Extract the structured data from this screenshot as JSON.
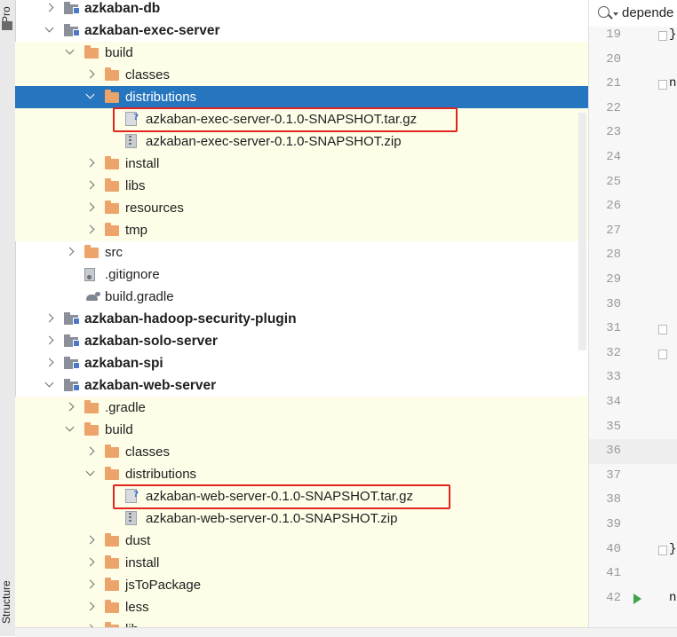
{
  "left_strip": {
    "top_tab": "Pro",
    "bottom_tab": "Structure"
  },
  "tree": {
    "rows": [
      {
        "label": "azkaban-db",
        "icon": "module-icon",
        "arrow": "right",
        "indent": 0,
        "bold": true,
        "highlight": false,
        "selected": false
      },
      {
        "label": "azkaban-exec-server",
        "icon": "module-icon",
        "arrow": "down",
        "indent": 0,
        "bold": true,
        "highlight": false,
        "selected": false
      },
      {
        "label": "build",
        "icon": "folder-icon",
        "arrow": "down",
        "indent": 1,
        "bold": false,
        "highlight": true,
        "selected": false
      },
      {
        "label": "classes",
        "icon": "folder-icon",
        "arrow": "right",
        "indent": 2,
        "bold": false,
        "highlight": true,
        "selected": false
      },
      {
        "label": "distributions",
        "icon": "folder-icon",
        "arrow": "down",
        "indent": 2,
        "bold": false,
        "highlight": false,
        "selected": true
      },
      {
        "label": "azkaban-exec-server-0.1.0-SNAPSHOT.tar.gz",
        "icon": "unknown-file-icon",
        "arrow": "none",
        "indent": 3,
        "bold": false,
        "highlight": true,
        "selected": false
      },
      {
        "label": "azkaban-exec-server-0.1.0-SNAPSHOT.zip",
        "icon": "archive-icon",
        "arrow": "none",
        "indent": 3,
        "bold": false,
        "highlight": true,
        "selected": false
      },
      {
        "label": "install",
        "icon": "folder-icon",
        "arrow": "right",
        "indent": 2,
        "bold": false,
        "highlight": true,
        "selected": false
      },
      {
        "label": "libs",
        "icon": "folder-icon",
        "arrow": "right",
        "indent": 2,
        "bold": false,
        "highlight": true,
        "selected": false
      },
      {
        "label": "resources",
        "icon": "folder-icon",
        "arrow": "right",
        "indent": 2,
        "bold": false,
        "highlight": true,
        "selected": false
      },
      {
        "label": "tmp",
        "icon": "folder-icon",
        "arrow": "right",
        "indent": 2,
        "bold": false,
        "highlight": true,
        "selected": false
      },
      {
        "label": "src",
        "icon": "folder-icon",
        "arrow": "right",
        "indent": 1,
        "bold": false,
        "highlight": false,
        "selected": false
      },
      {
        "label": ".gitignore",
        "icon": "gitignore-icon",
        "arrow": "none",
        "indent": 1,
        "bold": false,
        "highlight": false,
        "selected": false
      },
      {
        "label": "build.gradle",
        "icon": "gradle-icon",
        "arrow": "none",
        "indent": 1,
        "bold": false,
        "highlight": false,
        "selected": false
      },
      {
        "label": "azkaban-hadoop-security-plugin",
        "icon": "module-icon",
        "arrow": "right",
        "indent": 0,
        "bold": true,
        "highlight": false,
        "selected": false
      },
      {
        "label": "azkaban-solo-server",
        "icon": "module-icon",
        "arrow": "right",
        "indent": 0,
        "bold": true,
        "highlight": false,
        "selected": false
      },
      {
        "label": "azkaban-spi",
        "icon": "module-icon",
        "arrow": "right",
        "indent": 0,
        "bold": true,
        "highlight": false,
        "selected": false
      },
      {
        "label": "azkaban-web-server",
        "icon": "module-icon",
        "arrow": "down",
        "indent": 0,
        "bold": true,
        "highlight": false,
        "selected": false
      },
      {
        "label": ".gradle",
        "icon": "folder-icon",
        "arrow": "right",
        "indent": 1,
        "bold": false,
        "highlight": true,
        "selected": false
      },
      {
        "label": "build",
        "icon": "folder-icon",
        "arrow": "down",
        "indent": 1,
        "bold": false,
        "highlight": true,
        "selected": false
      },
      {
        "label": "classes",
        "icon": "folder-icon",
        "arrow": "right",
        "indent": 2,
        "bold": false,
        "highlight": true,
        "selected": false
      },
      {
        "label": "distributions",
        "icon": "folder-icon",
        "arrow": "down",
        "indent": 2,
        "bold": false,
        "highlight": true,
        "selected": false
      },
      {
        "label": "azkaban-web-server-0.1.0-SNAPSHOT.tar.gz",
        "icon": "unknown-file-icon",
        "arrow": "none",
        "indent": 3,
        "bold": false,
        "highlight": true,
        "selected": false
      },
      {
        "label": "azkaban-web-server-0.1.0-SNAPSHOT.zip",
        "icon": "archive-icon",
        "arrow": "none",
        "indent": 3,
        "bold": false,
        "highlight": true,
        "selected": false
      },
      {
        "label": "dust",
        "icon": "folder-icon",
        "arrow": "right",
        "indent": 2,
        "bold": false,
        "highlight": true,
        "selected": false
      },
      {
        "label": "install",
        "icon": "folder-icon",
        "arrow": "right",
        "indent": 2,
        "bold": false,
        "highlight": true,
        "selected": false
      },
      {
        "label": "jsToPackage",
        "icon": "folder-icon",
        "arrow": "right",
        "indent": 2,
        "bold": false,
        "highlight": true,
        "selected": false
      },
      {
        "label": "less",
        "icon": "folder-icon",
        "arrow": "right",
        "indent": 2,
        "bold": false,
        "highlight": true,
        "selected": false
      },
      {
        "label": "lib",
        "icon": "folder-icon",
        "arrow": "right",
        "indent": 2,
        "bold": false,
        "highlight": true,
        "selected": false
      }
    ],
    "annotated_rows": [
      5,
      22
    ]
  },
  "editor": {
    "search_query": "depende",
    "current_line": "36",
    "lines": [
      {
        "num": "19",
        "code": "}"
      },
      {
        "num": "20",
        "code": ""
      },
      {
        "num": "21",
        "code": "n"
      },
      {
        "num": "22",
        "code": ""
      },
      {
        "num": "23",
        "code": ""
      },
      {
        "num": "24",
        "code": ""
      },
      {
        "num": "25",
        "code": ""
      },
      {
        "num": "26",
        "code": ""
      },
      {
        "num": "27",
        "code": ""
      },
      {
        "num": "28",
        "code": ""
      },
      {
        "num": "29",
        "code": ""
      },
      {
        "num": "30",
        "code": ""
      },
      {
        "num": "31",
        "code": ""
      },
      {
        "num": "32",
        "code": ""
      },
      {
        "num": "33",
        "code": ""
      },
      {
        "num": "34",
        "code": ""
      },
      {
        "num": "35",
        "code": ""
      },
      {
        "num": "36",
        "code": ""
      },
      {
        "num": "37",
        "code": ""
      },
      {
        "num": "38",
        "code": ""
      },
      {
        "num": "39",
        "code": ""
      },
      {
        "num": "40",
        "code": "}"
      },
      {
        "num": "41",
        "code": ""
      },
      {
        "num": "42",
        "code": "n"
      }
    ],
    "fold_markers": [
      "19",
      "21",
      "31",
      "32",
      "40"
    ],
    "run_marker_line": "42"
  },
  "colors": {
    "selection": "#2675bf",
    "highlight_row": "#fdfde8",
    "folder": "#eca46a",
    "annotation": "#e0251c"
  }
}
